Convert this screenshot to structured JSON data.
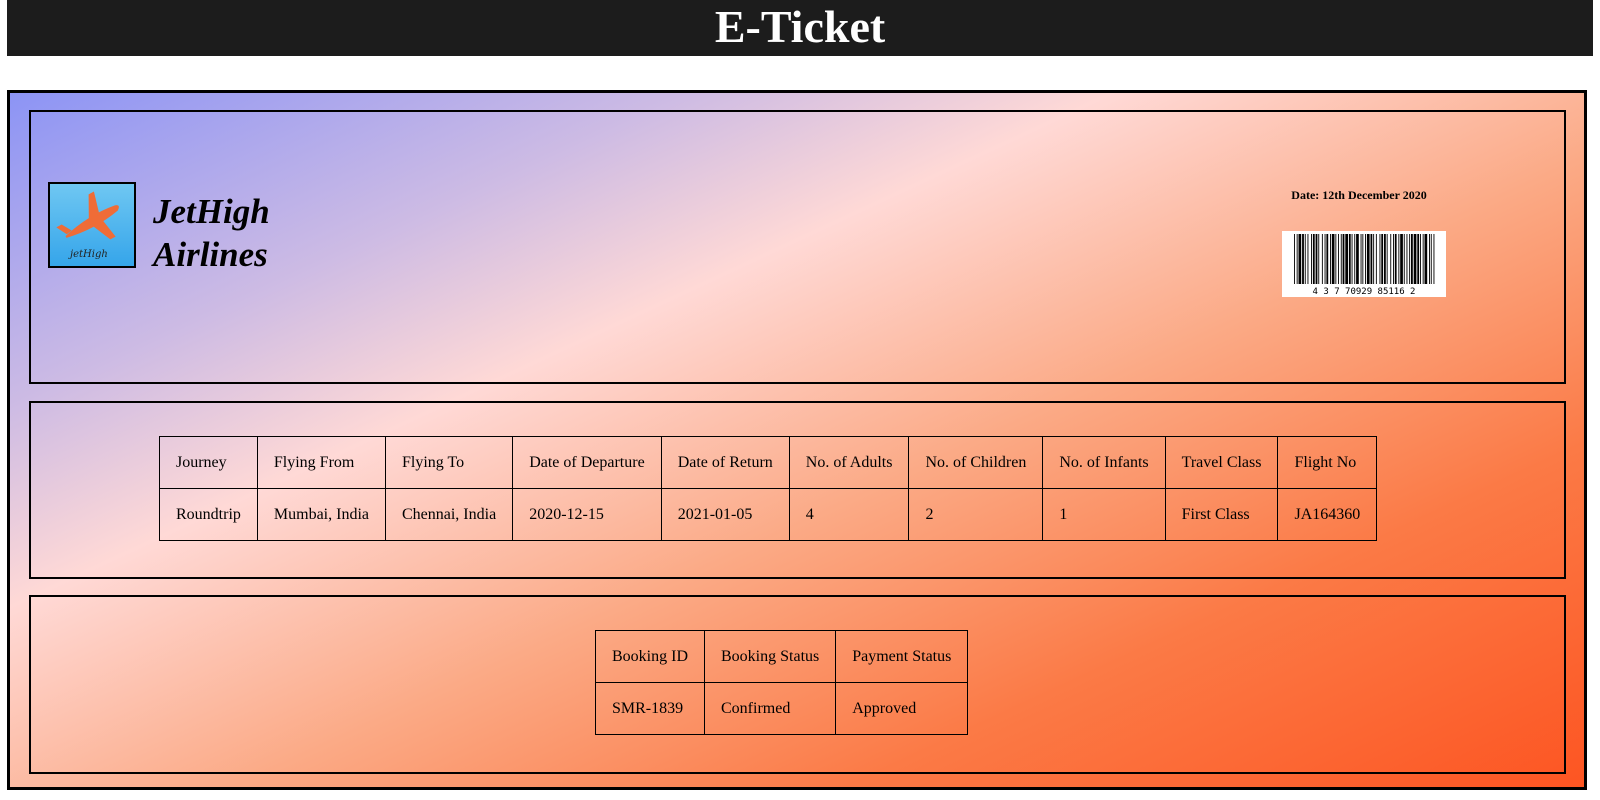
{
  "page": {
    "title": "E-Ticket"
  },
  "airline": {
    "name_line1": "JetHigh",
    "name_line2": "Airlines",
    "logo_icon": "airplane-icon",
    "logo_signature": "jetHigh"
  },
  "ticket_info": {
    "date_label": "Date: 12th December 2020",
    "barcode_number": "4 3 7 70929 85116 2"
  },
  "journey": {
    "headers": [
      "Journey",
      "Flying From",
      "Flying To",
      "Date of Departure",
      "Date of Return",
      "No. of Adults",
      "No. of Children",
      "No. of Infants",
      "Travel Class",
      "Flight No"
    ],
    "values": [
      "Roundtrip",
      "Mumbai, India",
      "Chennai, India",
      "2020-12-15",
      "2021-01-05",
      "4",
      "2",
      "1",
      "First Class",
      "JA164360"
    ]
  },
  "booking": {
    "headers": [
      "Booking ID",
      "Booking Status",
      "Payment Status"
    ],
    "values": [
      "SMR-1839",
      "Confirmed",
      "Approved"
    ]
  },
  "colors": {
    "title_bar": "#1c1c1c",
    "gradient_start": "#8c94f5",
    "gradient_mid": "#ffd9d6",
    "gradient_end": "#fd5522",
    "logo_plane": "#ef6c37",
    "logo_background": "#35a5ea"
  }
}
